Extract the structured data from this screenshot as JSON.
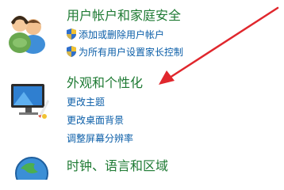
{
  "categories": [
    {
      "title": "用户帐户和家庭安全",
      "links": [
        "添加或删除用户帐户",
        "为所有用户设置家长控制"
      ]
    },
    {
      "title": "外观和个性化",
      "links": [
        "更改主题",
        "更改桌面背景",
        "调整屏幕分辨率"
      ]
    },
    {
      "title": "时钟、语言和区域",
      "links": []
    }
  ],
  "colors": {
    "category_title": "#1e7a33",
    "link": "#0b5ea8",
    "annotation_arrow": "#e0272d"
  }
}
